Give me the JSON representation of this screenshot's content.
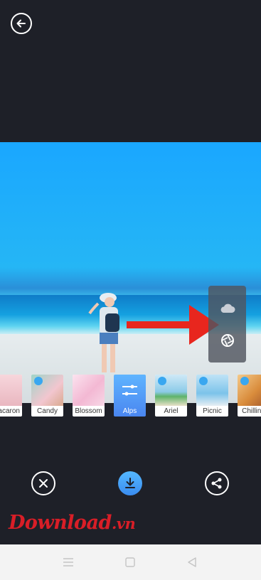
{
  "header": {
    "back_icon": "arrow-left-circle-icon"
  },
  "cloud_panel": {
    "top_icon": "cloud-icon",
    "bottom_icon": "aperture-icon"
  },
  "filters": [
    {
      "label": "Macaron",
      "selected": false,
      "cloud": false
    },
    {
      "label": "Candy",
      "selected": false,
      "cloud": true
    },
    {
      "label": "Blossom",
      "selected": false,
      "cloud": false
    },
    {
      "label": "Alps",
      "selected": true,
      "cloud": false
    },
    {
      "label": "Ariel",
      "selected": false,
      "cloud": true
    },
    {
      "label": "Picnic",
      "selected": false,
      "cloud": true
    },
    {
      "label": "Chilling",
      "selected": false,
      "cloud": true
    }
  ],
  "actions": {
    "cancel_icon": "close-circle-icon",
    "save_icon": "download-icon",
    "share_icon": "share-icon"
  },
  "watermark": {
    "brand": "Download",
    "tld": ".vn"
  },
  "navbar": {
    "menu_icon": "menu-icon",
    "home_icon": "square-home-icon",
    "back_icon": "triangle-back-icon"
  },
  "colors": {
    "accent": "#4a9cf5",
    "arrow": "#e8261e",
    "background": "#1e2028"
  }
}
